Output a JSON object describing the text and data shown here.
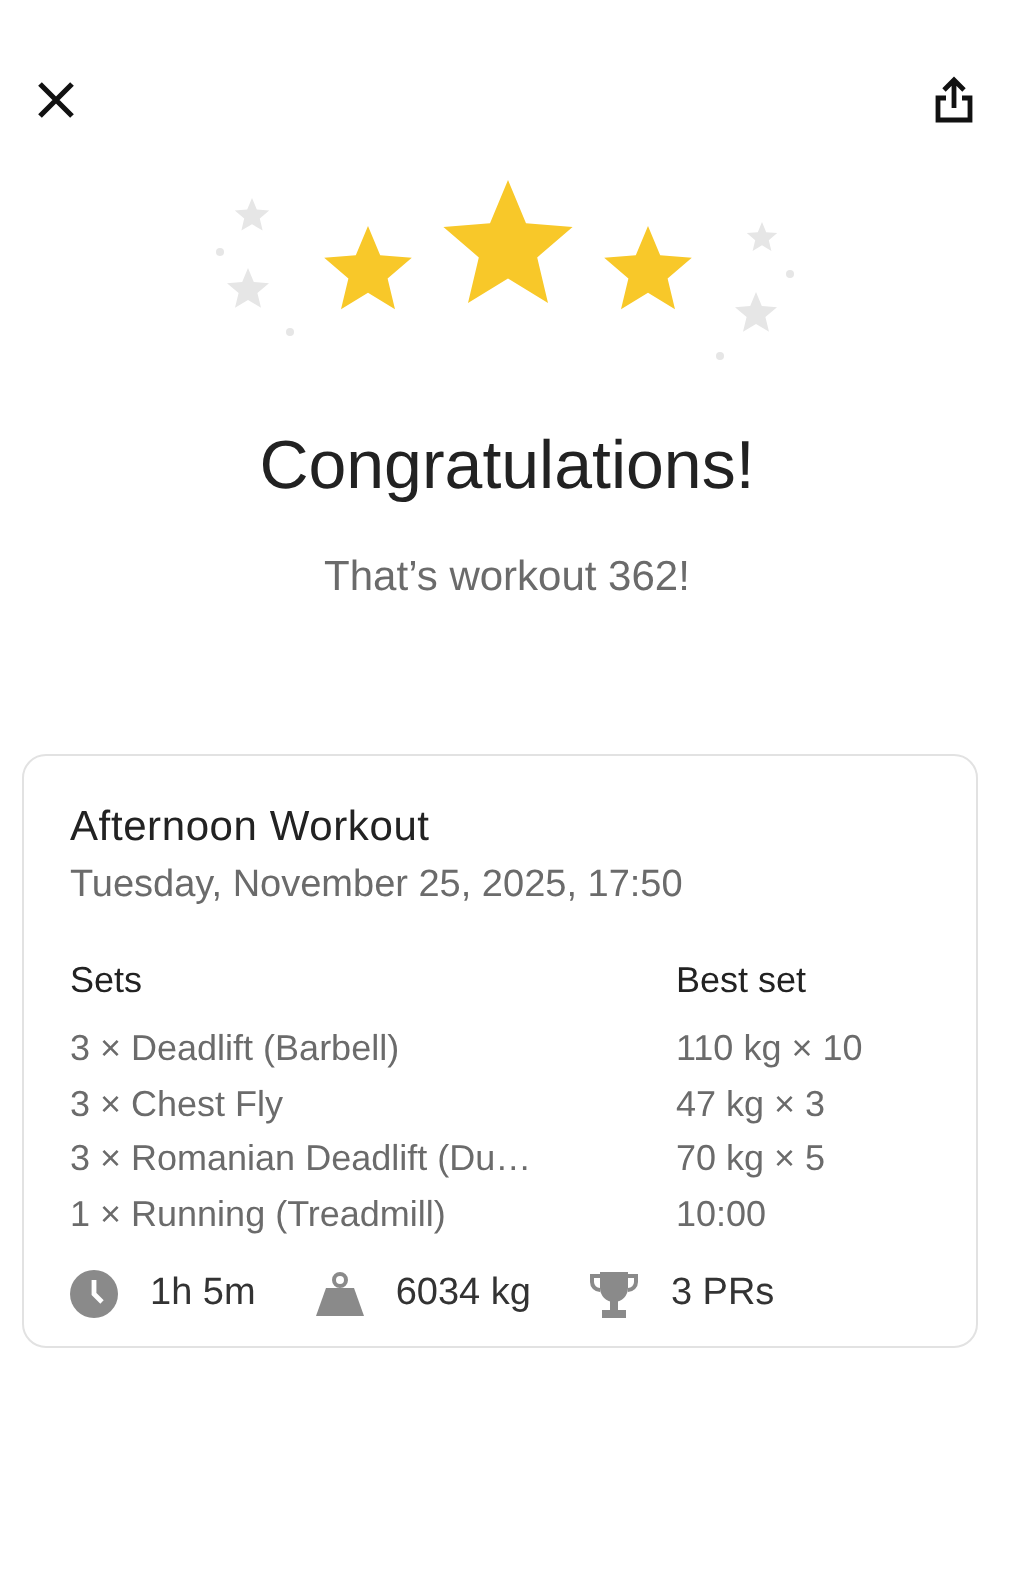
{
  "title": "Congratulations!",
  "subtitle": "That’s workout 362!",
  "workout": {
    "name": "Afternoon Workout",
    "date": "Tuesday, November 25, 2025, 17:50",
    "columns": [
      "Sets",
      "Best set"
    ],
    "rows": [
      {
        "sets": "3 × Deadlift (Barbell)",
        "best": "110 kg × 10"
      },
      {
        "sets": "3 × Chest Fly",
        "best": "47 kg × 3"
      },
      {
        "sets": "3 × Romanian Deadlift (Du…",
        "best": "70 kg × 5"
      },
      {
        "sets": "1 × Running (Treadmill)",
        "best": "10:00"
      }
    ],
    "stats": [
      {
        "kind": "duration",
        "value": "1h 5m"
      },
      {
        "kind": "volume",
        "value": "6034 kg"
      },
      {
        "kind": "prs",
        "value": "3 PRs"
      }
    ]
  }
}
